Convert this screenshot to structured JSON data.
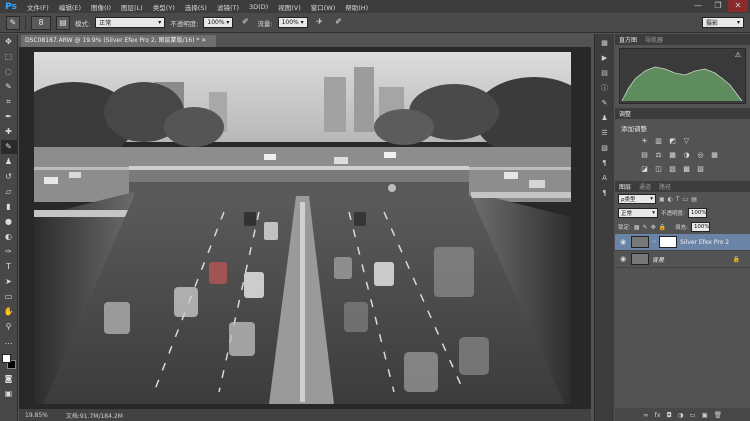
{
  "menubar": {
    "logo": "Ps",
    "items": [
      "文件(F)",
      "编辑(E)",
      "图像(I)",
      "图层(L)",
      "类型(Y)",
      "选择(S)",
      "滤镜(T)",
      "3D(D)",
      "视图(V)",
      "窗口(W)",
      "帮助(H)"
    ],
    "controls": {
      "minimize": "—",
      "restore": "❐",
      "close": "✕"
    }
  },
  "options": {
    "brush_size": "8",
    "mode_label": "模式:",
    "mode_value": "正常",
    "opacity_label": "不透明度:",
    "opacity_value": "100%",
    "flow_label": "流量:",
    "flow_value": "100%",
    "workspace_value": "摄影"
  },
  "document": {
    "tab_title": "DSC08187.ARW @ 19.9% (Silver Efex Pro 2, 图层蒙版/16) * ✕",
    "zoom": "19.85%",
    "doc_size": "文档:91.7M/184.2M"
  },
  "panels": {
    "histogram_tabs": [
      "直方图",
      "导航器"
    ],
    "adjust_tab": "调整",
    "adjust_title": "添加调整",
    "adjust_icons": [
      [
        "☀",
        "▥",
        "◩",
        "▽"
      ],
      [
        "▤",
        "⚖",
        "▦",
        "◑",
        "◎",
        "▦"
      ],
      [
        "◪",
        "◫",
        "▨",
        "▩",
        "▧"
      ]
    ],
    "layers_tabs": [
      "图层",
      "通道",
      "路径"
    ],
    "kind_label": "ρ类型",
    "blend_mode": "正常",
    "opacity_label": "不透明度:",
    "opacity_value": "100%",
    "lock_label": "锁定:",
    "fill_label": "填充:",
    "fill_value": "100%",
    "layers": [
      {
        "name": "Silver Efex Pro 2"
      },
      {
        "name": "背景"
      }
    ]
  }
}
